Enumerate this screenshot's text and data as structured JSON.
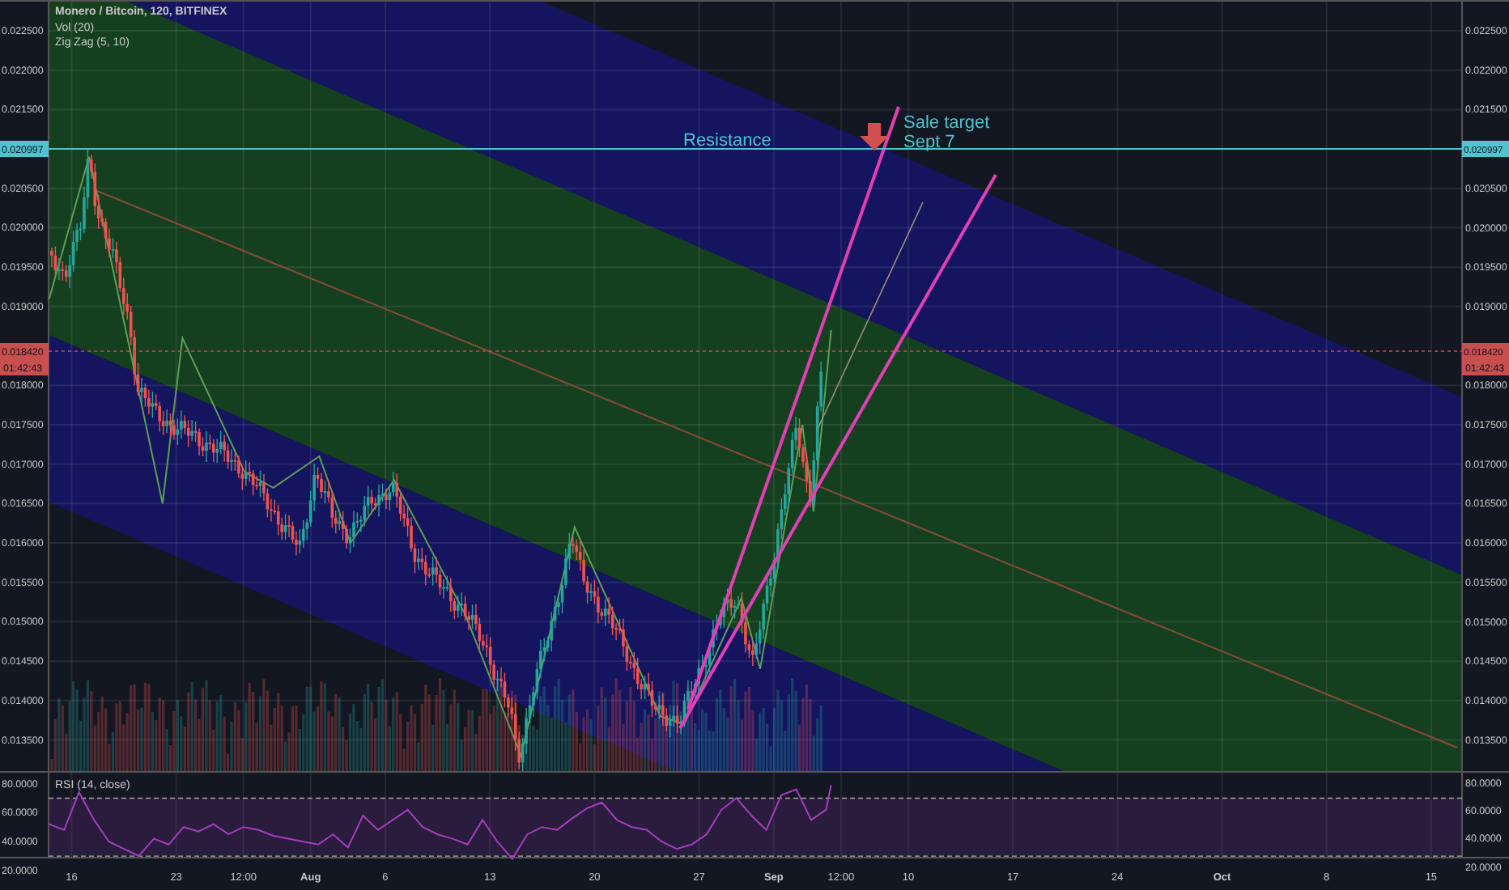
{
  "legend": {
    "title": "Monero / Bitcoin, 120, BITFINEX",
    "indicators": [
      "Vol (20)"
    ]
  },
  "chart_data": {
    "type": "line",
    "x": [
      "--07-14 12:00",
      "--07-17 04:00",
      "--07-22 02:00",
      "--07-23 10:00",
      "--07-27 14:00",
      "--07-29 12:00",
      "--08-01 14:00",
      "--08-03 16:00",
      "--08-06 14:00",
      "--08-11 08:00",
      "--08-15 02:00",
      "--08-18 16:00",
      "--08-24 10:00",
      "--08-26 00:00",
      "--08-29 20:00",
      "--08-31 02:00",
      "--09-02 22:00",
      "--09-03 16:00",
      "--09-04 20:00"
    ],
    "xlim": [
      "--07-11 05:00",
      "--10-20 05:00"
    ],
    "ylim": [
      0.013095,
      0.02289
    ],
    "xticks": [
      {
        "value": "--07-16 00:00",
        "label": "16"
      },
      {
        "value": "--07-23 00:00",
        "label": "23"
      },
      {
        "value": "--07-27 12:00",
        "label": "12:00"
      },
      {
        "value": "--08-01 00:00",
        "label": "Aug"
      },
      {
        "value": "--08-06 00:00",
        "label": "6"
      },
      {
        "value": "--08-13 00:00",
        "label": "13"
      },
      {
        "value": "--08-20 00:00",
        "label": "20"
      },
      {
        "value": "--08-27 00:00",
        "label": "27"
      },
      {
        "value": "--09-01 00:00",
        "label": "Sep"
      },
      {
        "value": "--09-05 12:00",
        "label": "12:00"
      },
      {
        "value": "--09-10 00:00",
        "label": "10"
      },
      {
        "value": "--09-17 00:00",
        "label": "17"
      },
      {
        "value": "--09-24 00:00",
        "label": "24"
      },
      {
        "value": "--10-01 00:00",
        "label": "Oct"
      },
      {
        "value": "--10-08 00:00",
        "label": "8"
      },
      {
        "value": "--10-15 00:00",
        "label": "15"
      }
    ],
    "yticks": [
      {
        "value": 0.0225,
        "label": "0.022500"
      },
      {
        "value": 0.022,
        "label": "0.022000"
      },
      {
        "value": 0.0215,
        "label": "0.021500"
      },
      {
        "value": 0.0205,
        "label": "0.020500"
      },
      {
        "value": 0.02,
        "label": "0.020000"
      },
      {
        "value": 0.0195,
        "label": "0.019500"
      },
      {
        "value": 0.019,
        "label": "0.019000"
      },
      {
        "value": 0.018,
        "label": "0.018000"
      },
      {
        "value": 0.0175,
        "label": "0.017500"
      },
      {
        "value": 0.017,
        "label": "0.017000"
      },
      {
        "value": 0.0165,
        "label": "0.016500"
      },
      {
        "value": 0.016,
        "label": "0.016000"
      },
      {
        "value": 0.0155,
        "label": "0.015500"
      },
      {
        "value": 0.015,
        "label": "0.015000"
      },
      {
        "value": 0.0145,
        "label": "0.014500"
      },
      {
        "value": 0.014,
        "label": "0.014000"
      },
      {
        "value": 0.0135,
        "label": "0.013500"
      }
    ],
    "series": [
      {
        "name": "Zig Zag (5, 10)",
        "color": "#5f9d58",
        "values": [
          0.0191,
          0.0209,
          0.0165,
          0.0186,
          0.0169,
          0.0167,
          0.0171,
          0.016,
          0.0168,
          0.0151,
          0.0133,
          0.0162,
          0.0138,
          0.0137,
          0.0153,
          0.0144,
          0.0175,
          0.0164,
          0.0187
        ]
      }
    ]
  },
  "right_price_ticks": [
    "0.022500",
    "0.022000",
    "0.021500",
    "0.020500",
    "0.020000",
    "0.019500",
    "0.019000",
    "0.018000",
    "0.017500",
    "0.017000",
    "0.016500",
    "0.016000",
    "0.015500",
    "0.015000",
    "0.014500",
    "0.014000",
    "0.013500"
  ],
  "left_price_tags": [
    {
      "kind": "line",
      "label": "0.020997",
      "color": "#4fc3cf"
    },
    {
      "kind": "last",
      "label": "0.018420",
      "countdown": "01:42:43",
      "color": "#c94f4f"
    }
  ],
  "right_price_tags": [
    {
      "kind": "line",
      "label": "0.020997",
      "color": "#4fc3cf"
    },
    {
      "kind": "last",
      "label": "0.018420",
      "countdown": "01:42:43",
      "color": "#c94f4f"
    }
  ],
  "annotations": {
    "resistance": "Resistance",
    "target": [
      "Sale target",
      "Sept 7"
    ]
  },
  "rsi": {
    "right_ticks": [
      "80.0000",
      "60.0000",
      "40.0000",
      "20.0000"
    ],
    "chart_data": {
      "type": "line",
      "xlim": [
        "--07-11 05:00",
        "--10-20 05:00"
      ],
      "ylim": [
        -0.65,
        88.1
      ],
      "ref_lines": [
        {
          "axis": "y",
          "value": 70
        },
        {
          "axis": "y",
          "value": 30
        }
      ],
      "bands": [
        {
          "axis": "y",
          "from": 30,
          "to": 70
        }
      ],
      "yticks": [
        {
          "value": 80,
          "label": "80.0000"
        },
        {
          "value": 60,
          "label": "60.0000"
        },
        {
          "value": 40,
          "label": "40.0000"
        },
        {
          "value": 20,
          "label": "20.0000"
        }
      ],
      "x": [
        "--07-14 12:00",
        "--07-15 12:00",
        "--07-16 12:00",
        "--07-17 12:00",
        "--07-18 12:00",
        "--07-19 12:00",
        "--07-20 12:00",
        "--07-21 12:00",
        "--07-22 12:00",
        "--07-23 12:00",
        "--07-24 12:00",
        "--07-25 12:00",
        "--07-26 12:00",
        "--07-27 12:00",
        "--07-28 12:00",
        "--07-29 12:00",
        "--07-30 12:00",
        "--07-31 12:00",
        "--08-01 12:00",
        "--08-02 12:00",
        "--08-03 12:00",
        "--08-04 12:00",
        "--08-05 12:00",
        "--08-06 12:00",
        "--08-07 12:00",
        "--08-08 12:00",
        "--08-09 12:00",
        "--08-10 12:00",
        "--08-11 12:00",
        "--08-12 12:00",
        "--08-13 12:00",
        "--08-14 12:00",
        "--08-15 12:00",
        "--08-16 12:00",
        "--08-17 12:00",
        "--08-18 12:00",
        "--08-19 12:00",
        "--08-20 12:00",
        "--08-21 12:00",
        "--08-22 12:00",
        "--08-23 12:00",
        "--08-24 12:00",
        "--08-25 12:00",
        "--08-26 12:00",
        "--08-27 12:00",
        "--08-28 12:00",
        "--08-29 12:00",
        "--08-30 12:00",
        "--08-31 12:00",
        "--09-01 12:00",
        "--09-02 12:00",
        "--09-03 12:00",
        "--09-04 12:00",
        "--09-04 20:00"
      ],
      "series": [
        {
          "name": "RSI (14, close)",
          "color": "#a63dbd",
          "values": [
            52,
            48,
            74,
            55,
            40,
            35,
            30,
            42,
            38,
            50,
            47,
            52,
            45,
            50,
            48,
            44,
            42,
            40,
            38,
            45,
            36,
            58,
            48,
            55,
            62,
            50,
            45,
            42,
            38,
            55,
            40,
            28,
            45,
            50,
            48,
            56,
            63,
            67,
            55,
            50,
            48,
            40,
            35,
            38,
            45,
            62,
            70,
            58,
            48,
            72,
            76,
            55,
            62,
            79
          ]
        }
      ]
    }
  }
}
